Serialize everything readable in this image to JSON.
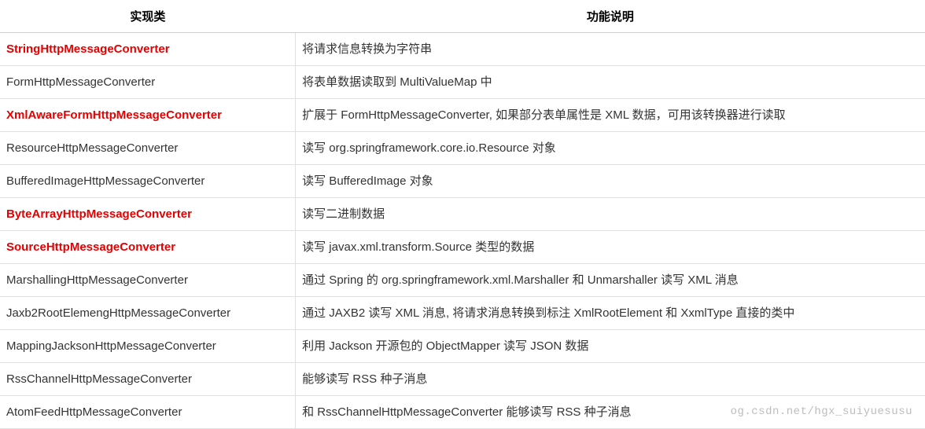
{
  "headers": {
    "col1": "实现类",
    "col2": "功能说明"
  },
  "rows": [
    {
      "name": "StringHttpMessageConverter",
      "highlight": true,
      "desc": "将请求信息转换为字符串"
    },
    {
      "name": "FormHttpMessageConverter",
      "highlight": false,
      "desc": "将表单数据读取到 MultiValueMap 中"
    },
    {
      "name": "XmlAwareFormHttpMessageConverter",
      "highlight": true,
      "desc": "扩展于 FormHttpMessageConverter, 如果部分表单属性是 XML 数据，可用该转换器进行读取"
    },
    {
      "name": "ResourceHttpMessageConverter",
      "highlight": false,
      "desc": "读写 org.springframework.core.io.Resource 对象"
    },
    {
      "name": "BufferedImageHttpMessageConverter",
      "highlight": false,
      "desc": "读写 BufferedImage 对象"
    },
    {
      "name": "ByteArrayHttpMessageConverter",
      "highlight": true,
      "desc": "读写二进制数据"
    },
    {
      "name": "SourceHttpMessageConverter",
      "highlight": true,
      "desc": "读写 javax.xml.transform.Source 类型的数据"
    },
    {
      "name": "MarshallingHttpMessageConverter",
      "highlight": false,
      "desc": "通过 Spring 的 org.springframework.xml.Marshaller 和 Unmarshaller 读写 XML 消息"
    },
    {
      "name": "Jaxb2RootElemengHttpMessageConverter",
      "highlight": false,
      "desc": "通过 JAXB2 读写 XML 消息, 将请求消息转换到标注 XmlRootElement 和 XxmlType 直接的类中"
    },
    {
      "name": "MappingJacksonHttpMessageConverter",
      "highlight": false,
      "desc": "利用 Jackson 开源包的 ObjectMapper 读写 JSON 数据"
    },
    {
      "name": "RssChannelHttpMessageConverter",
      "highlight": false,
      "desc": "能够读写 RSS 种子消息"
    },
    {
      "name": "AtomFeedHttpMessageConverter",
      "highlight": false,
      "desc": "和 RssChannelHttpMessageConverter 能够读写 RSS 种子消息"
    }
  ],
  "watermark": "og.csdn.net/hgx_suiyuesusu"
}
